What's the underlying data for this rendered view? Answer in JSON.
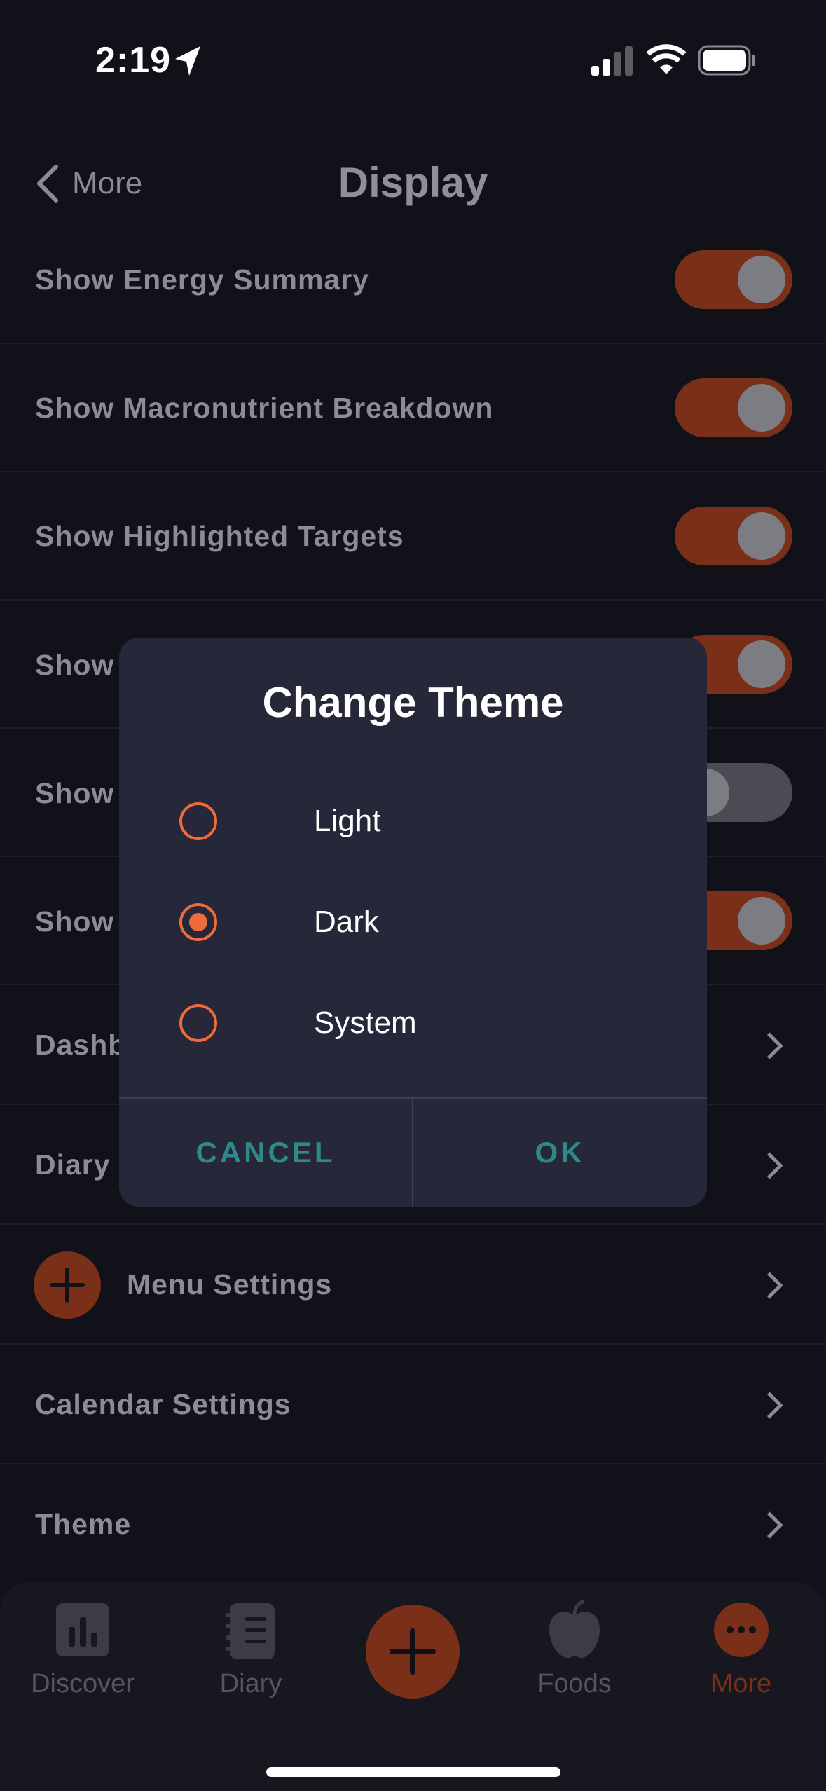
{
  "status": {
    "time": "2:19"
  },
  "nav": {
    "back_label": "More",
    "title": "Display"
  },
  "rows": {
    "r0": "Show Energy Summary",
    "r1": "Show Macronutrient Breakdown",
    "r2": "Show Highlighted Targets",
    "r3": "Show",
    "r4": "Show",
    "r5": "Show",
    "r6": "Dashb",
    "r7": "Diary",
    "r8": "Menu Settings",
    "r9": "Calendar Settings",
    "r10": "Theme"
  },
  "dialog": {
    "title": "Change Theme",
    "options": [
      "Light",
      "Dark",
      "System"
    ],
    "selected": "Dark",
    "cancel": "CANCEL",
    "ok": "OK"
  },
  "tabs": {
    "discover": "Discover",
    "diary": "Diary",
    "foods": "Foods",
    "more": "More"
  },
  "colors": {
    "accent": "#f06a3a",
    "toggle_on": "#7a2f18",
    "teal": "#2e8a8a",
    "background": "#101119"
  }
}
